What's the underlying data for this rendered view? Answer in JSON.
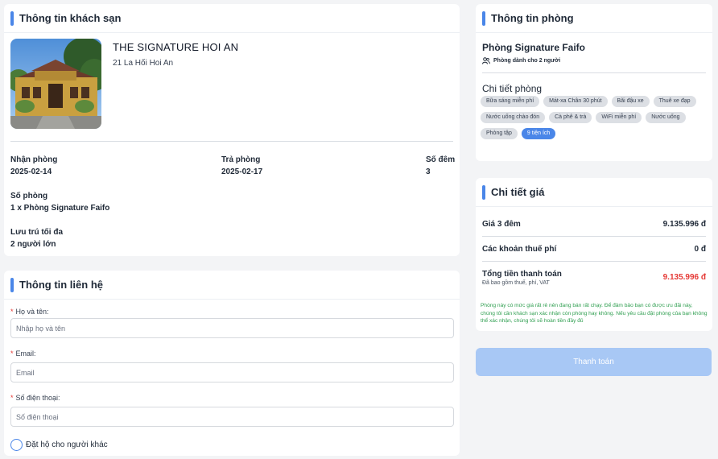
{
  "hotel_section": {
    "title": "Thông tin khách sạn",
    "name": "THE SIGNATURE HOI AN",
    "address": "21 La Hối Hoi An",
    "checkin_label": "Nhận phòng",
    "checkin_value": "2025-02-14",
    "checkout_label": "Trả phòng",
    "checkout_value": "2025-02-17",
    "nights_label": "Số đêm",
    "nights_value": "3",
    "rooms_label": "Số phòng",
    "rooms_value": "1 x Phòng Signature Faifo",
    "max_label": "Lưu trú tối đa",
    "max_value": "2 người lớn"
  },
  "contact_section": {
    "title": "Thông tin liên hệ",
    "name_label": "Họ và tên:",
    "name_placeholder": "Nhập họ và tên",
    "email_label": "Email:",
    "email_placeholder": "Email",
    "phone_label": "Số điện thoại:",
    "phone_placeholder": "Số điện thoại",
    "book_for_other_label": "Đặt hộ cho người khác"
  },
  "room_section": {
    "title": "Thông tin phòng",
    "room_name": "Phòng Signature Faifo",
    "guests": "Phòng dành cho 2 người",
    "details_title": "Chi tiết phòng",
    "amenities": [
      "Bữa sáng miễn phí",
      "Mát-xa Chân 30 phút",
      "Bãi đậu xe",
      "Thuê xe đạp",
      "Nước uống chào đón",
      "Cà phê & trà",
      "WiFi miễn phí",
      "Nước uống",
      "Phòng tập"
    ],
    "more_amenities": "9 tiện ích"
  },
  "price_section": {
    "title": "Chi tiết giá",
    "nights_price_label": "Giá 3 đêm",
    "nights_price_value": "9.135.996 đ",
    "tax_label": "Các khoản thuế phí",
    "tax_value": "0 đ",
    "total_label": "Tổng tiền thanh toán",
    "total_value": "9.135.996 đ",
    "total_note": "Đã bao gồm thuế, phí, VAT",
    "notice": "Phòng này có mức giá rất rẻ nên đang bán rất chạy. Để đảm bảo bạn có được ưu đãi này, chúng tôi cần khách sạn xác nhận còn phòng hay không. Nếu yêu cầu đặt phòng của bạn không thể xác nhận, chúng tôi sẽ hoàn tiền đầy đủ"
  },
  "pay_button": "Thanh toán",
  "colors": {
    "accent": "#4a86e8",
    "pay_button": "#a8c8f5",
    "total": "#e53935",
    "notice": "#2e9e4f"
  }
}
